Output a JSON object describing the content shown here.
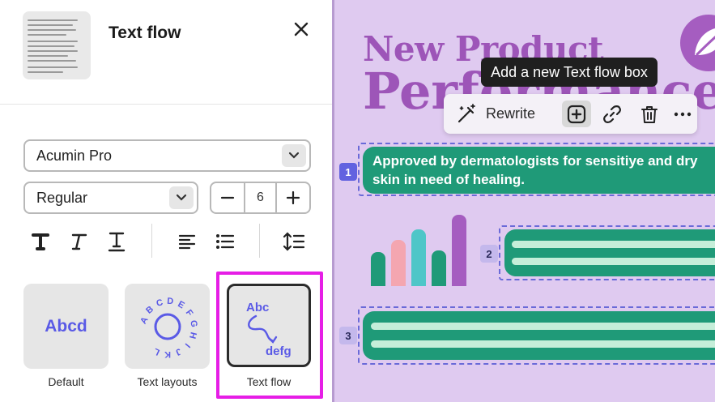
{
  "panel": {
    "title": "Text flow",
    "font_family": "Acumin Pro",
    "font_style": "Regular",
    "font_size": "6"
  },
  "cards": [
    {
      "label": "Default",
      "preview": "Abcd"
    },
    {
      "label": "Text layouts",
      "preview": "ABCDEFGHIJKL"
    },
    {
      "label": "Text flow",
      "preview_top": "Abc",
      "preview_bottom": "defg",
      "selected": true
    }
  ],
  "canvas": {
    "heading_line1": "New Product",
    "heading_line2": "Performance",
    "tooltip": "Add a new Text flow box",
    "toolbar": {
      "rewrite_label": "Rewrite"
    },
    "boxes": [
      {
        "number": "1",
        "text_line1": "Approved by dermatologists for sensitiye and dry",
        "text_line2": "skin in need of healing."
      },
      {
        "number": "2"
      },
      {
        "number": "3"
      }
    ],
    "chart_colors": [
      "#1f9a78",
      "#f4a6b0",
      "#4ec6c8",
      "#1f9a78",
      "#a55dc0"
    ],
    "chart_levels": [
      0.48,
      0.65,
      0.8,
      0.5,
      1.0
    ]
  },
  "colors": {
    "accent_magenta": "#e61ee6",
    "purple_heading": "#9d55b8",
    "green_box": "#1f9a78",
    "canvas_bg": "#dfcaf0"
  }
}
